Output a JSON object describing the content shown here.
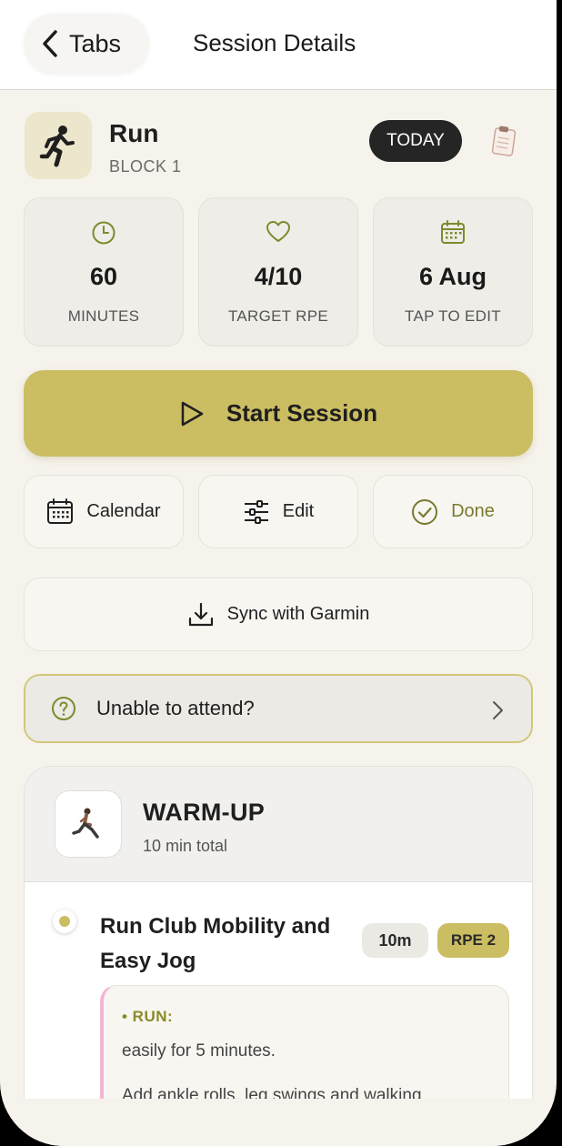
{
  "header": {
    "back_label": "Tabs",
    "title": "Session Details"
  },
  "session": {
    "activity": "Run",
    "block": "BLOCK 1",
    "badge": "TODAY"
  },
  "stats": [
    {
      "icon": "clock-icon",
      "value": "60",
      "label": "MINUTES"
    },
    {
      "icon": "heart-icon",
      "value": "4/10",
      "label": "TARGET RPE"
    },
    {
      "icon": "calendar-icon",
      "value": "6 Aug",
      "label": "TAP TO EDIT"
    }
  ],
  "start_label": "Start Session",
  "actions": {
    "calendar": "Calendar",
    "edit": "Edit",
    "done": "Done"
  },
  "sync_label": "Sync with Garmin",
  "unable_label": "Unable to attend?",
  "warmup": {
    "title": "WARM-UP",
    "subtitle": "10 min total",
    "exercise": {
      "title": "Run Club Mobility and Easy Jog",
      "duration": "10m",
      "rpe": "RPE 2",
      "tag": "• RUN:",
      "line1": "easily for 5 minutes.",
      "line2": "Add ankle rolls, leg swings and walking"
    }
  },
  "colors": {
    "accent": "#cbbd62",
    "background": "#f6f3ec",
    "badge_dark": "#252525",
    "done_green": "#7a7a30"
  }
}
